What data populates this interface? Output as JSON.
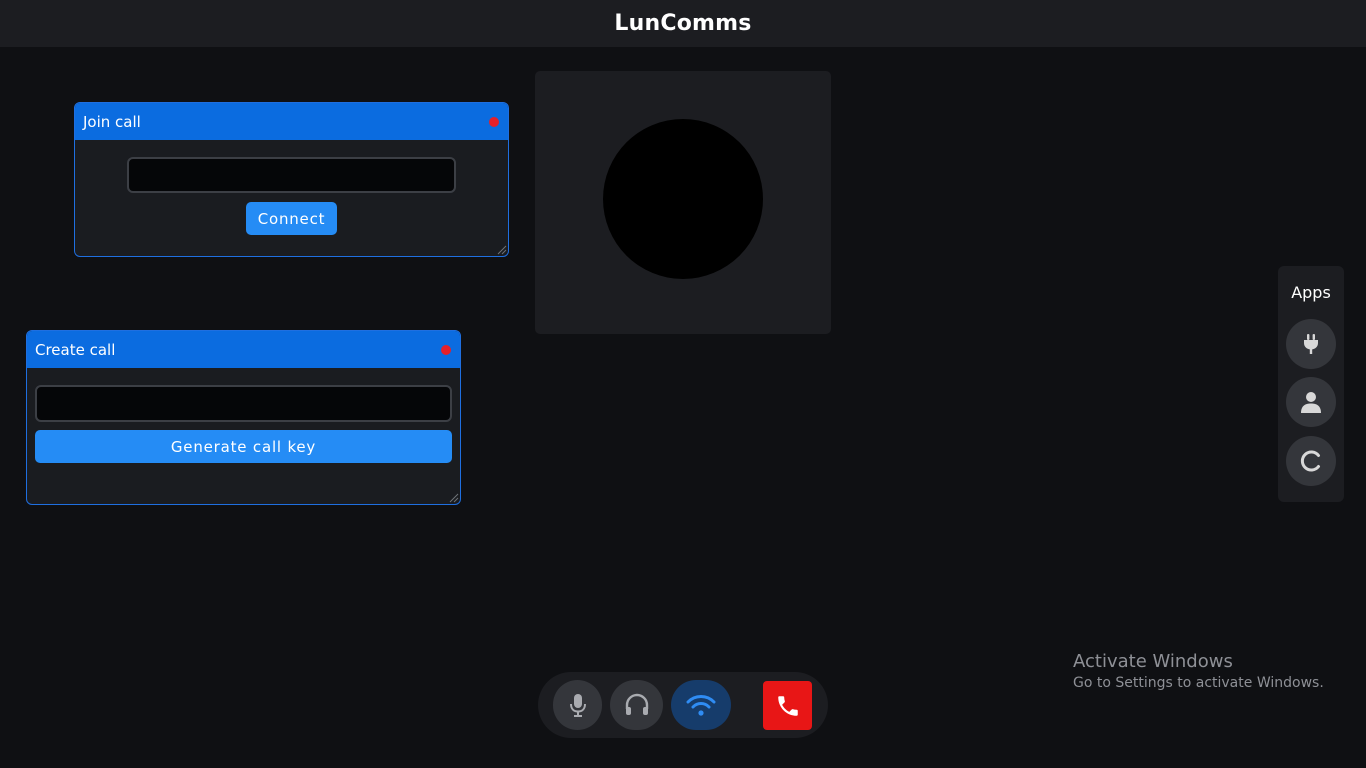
{
  "app": {
    "title": "LunComms"
  },
  "join_panel": {
    "title": "Join call",
    "input_value": "",
    "connect_label": "Connect"
  },
  "create_panel": {
    "title": "Create call",
    "input_value": "",
    "generate_label": "Generate call key"
  },
  "apps_panel": {
    "title": "Apps",
    "items": [
      "plug-icon",
      "user-icon",
      "refresh-icon"
    ]
  },
  "call_controls": {
    "buttons": [
      "microphone-icon",
      "headphones-icon",
      "wifi-icon",
      "hang-up-icon"
    ],
    "wifi_active": true
  },
  "colors": {
    "accent": "#258cf5",
    "panel_header": "#0b6ce0",
    "hangup": "#e81616",
    "close_dot": "#e5202a"
  },
  "watermark": {
    "line1": "Activate Windows",
    "line2": "Go to Settings to activate Windows."
  }
}
